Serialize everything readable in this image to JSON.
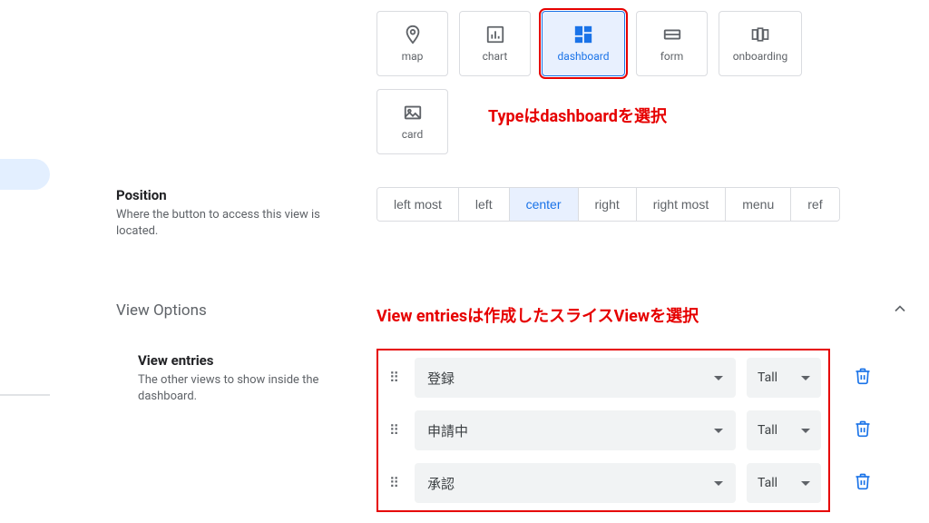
{
  "type_tiles_row1": [
    {
      "label": "map",
      "icon": "pin-icon"
    },
    {
      "label": "chart",
      "icon": "barchart-icon"
    },
    {
      "label": "dashboard",
      "icon": "dashboard-icon"
    },
    {
      "label": "form",
      "icon": "form-icon"
    },
    {
      "label": "onboarding",
      "icon": "onboarding-icon"
    }
  ],
  "type_tiles_row2": [
    {
      "label": "card",
      "icon": "image-icon"
    }
  ],
  "selected_type": "dashboard",
  "annotation_type": "Typeはdashboardを選択",
  "position": {
    "title": "Position",
    "desc": "Where the button to access this view is located.",
    "options": [
      "left most",
      "left",
      "center",
      "right",
      "right most",
      "menu",
      "ref"
    ],
    "selected": "center"
  },
  "view_options_title": "View Options",
  "annotation_entries": "View entriesは作成したスライスViewを選択",
  "view_entries": {
    "title": "View entries",
    "desc": "The other views to show inside the dashboard.",
    "rows": [
      {
        "view": "登録",
        "size": "Tall"
      },
      {
        "view": "申請中",
        "size": "Tall"
      },
      {
        "view": "承認",
        "size": "Tall"
      }
    ]
  }
}
